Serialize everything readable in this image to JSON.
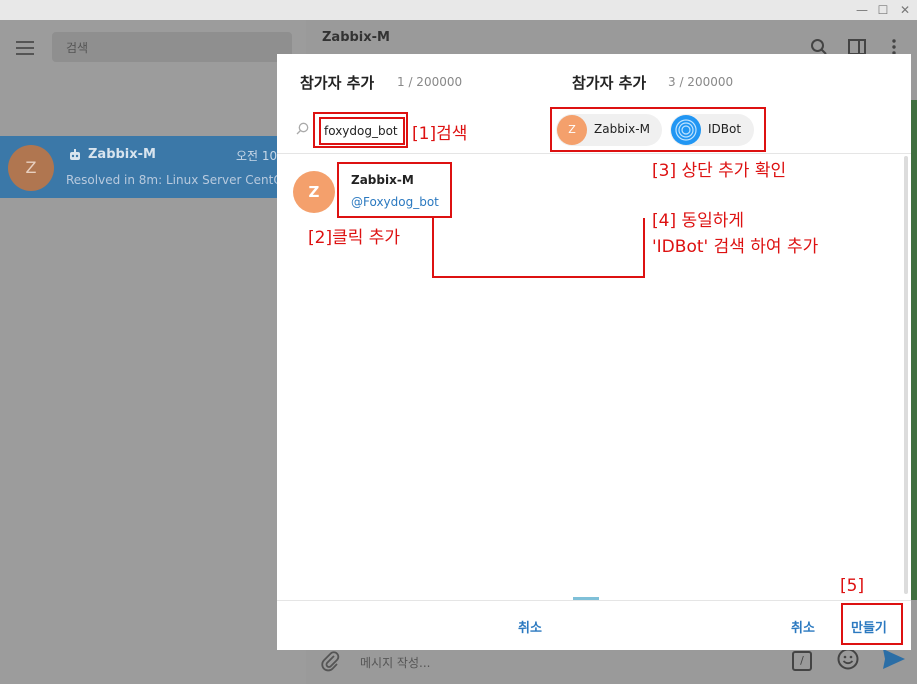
{
  "window": {
    "minimize": "—",
    "maximize": "☐",
    "close": "✕"
  },
  "sidebar": {
    "search_placeholder": "검색",
    "chat": {
      "avatar_letter": "Z",
      "name": "Zabbix-M",
      "time": "오전 10",
      "preview": "Resolved in 8m: Linux Server CentO"
    }
  },
  "chat_header": {
    "title": "Zabbix-M"
  },
  "composer": {
    "placeholder": "메시지 작성...",
    "command_icon": "/"
  },
  "dialog_left": {
    "title": "참가자 추가",
    "count": "1 / 200000",
    "search_value": "foxydog_bot",
    "result": {
      "avatar_letter": "Z",
      "name": "Zabbix-M",
      "username": "@Foxydog_bot"
    },
    "cancel_label": "취소"
  },
  "dialog_right": {
    "title": "참가자 추가",
    "count": "3 / 200000",
    "chips": [
      {
        "letter": "Z",
        "label": "Zabbix-M",
        "color": "#f4a06c"
      },
      {
        "letter": "",
        "label": "IDBot",
        "color": "#2196f3"
      }
    ],
    "cancel_label": "취소",
    "create_label": "만들기"
  },
  "annotations": {
    "step1": "[1]검색",
    "step2": "[2]클릭 추가",
    "step3": "[3] 상단 추가 확인",
    "step4_line1": "[4] 동일하게",
    "step4_line2": "'IDBot' 검색 하여 추가",
    "step5": "[5]"
  },
  "colors": {
    "accent": "#2b79c0",
    "annotation_red": "#dd1111"
  }
}
